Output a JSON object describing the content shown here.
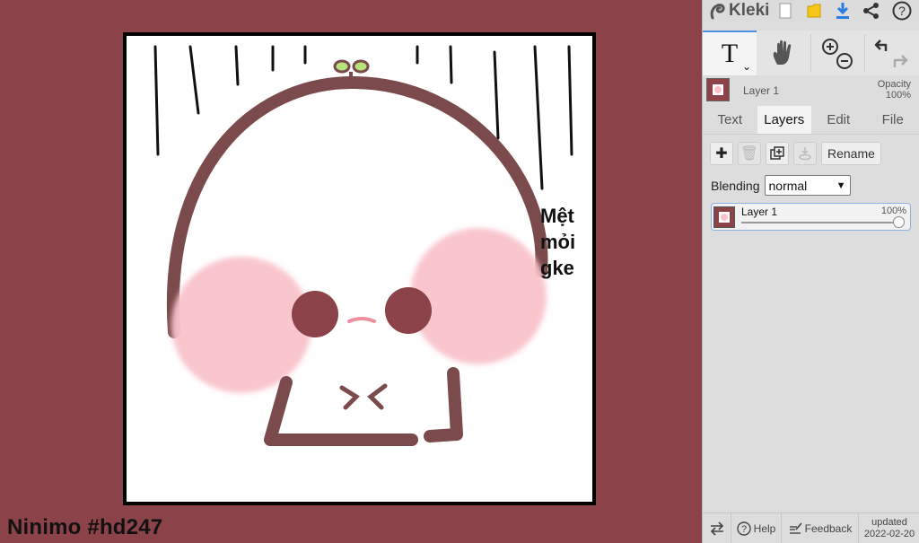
{
  "app": {
    "name": "Kleki"
  },
  "canvas": {
    "side_caption_lines": [
      "Mệt",
      "mỏi",
      "gke"
    ],
    "watermark": "Ninimo #hd247"
  },
  "toolbar": {
    "active_tool_glyph": "T",
    "tools": [
      "text-tool",
      "hand-tool",
      "zoom-in",
      "zoom-out",
      "undo",
      "redo"
    ]
  },
  "layer_preview": {
    "name": "Layer 1",
    "opacity_label": "Opacity",
    "opacity_value": "100%"
  },
  "tabs": [
    {
      "label": "Text",
      "active": false
    },
    {
      "label": "Layers",
      "active": true
    },
    {
      "label": "Edit",
      "active": false
    },
    {
      "label": "File",
      "active": false
    }
  ],
  "layers_panel": {
    "rename_label": "Rename",
    "blending_label": "Blending",
    "blending_value": "normal",
    "layers": [
      {
        "name": "Layer 1",
        "opacity": "100%",
        "opacity_fraction": 1.0
      }
    ]
  },
  "bottom": {
    "help_label": "Help",
    "feedback_label": "Feedback",
    "updated_label": "updated",
    "updated_date": "2022-02-20"
  },
  "colors": {
    "background": "#8b4349",
    "panel": "#dddddd",
    "accent": "#4a90e2",
    "character_outline": "#7a4a4c",
    "cheeks": "#f9c3cc"
  }
}
